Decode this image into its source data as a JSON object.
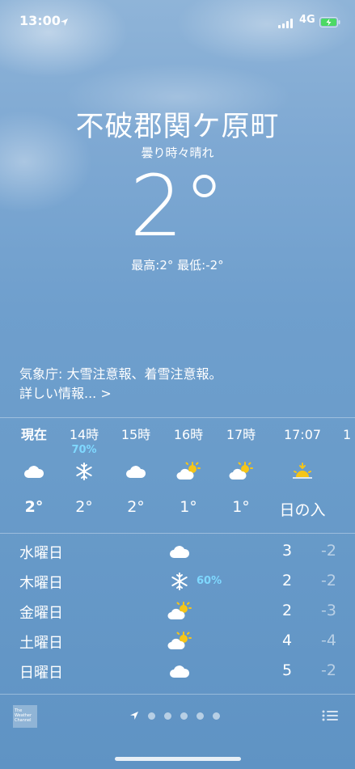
{
  "status_bar": {
    "time": "13:00",
    "network": "4G",
    "battery_charging": true
  },
  "current": {
    "location": "不破郡関ケ原町",
    "condition": "曇り時々晴れ",
    "temperature": "2°",
    "high_low": "最高:2° 最低:-2°"
  },
  "alert": {
    "text": "気象庁: 大雪注意報、着雪注意報。",
    "more_link": "詳しい情報... >"
  },
  "hourly": [
    {
      "label": "現在",
      "precip": "",
      "icon": "cloud-icon",
      "temp": "2°"
    },
    {
      "label": "14時",
      "precip": "70%",
      "icon": "snowflake-icon",
      "temp": "2°"
    },
    {
      "label": "15時",
      "precip": "",
      "icon": "cloud-icon",
      "temp": "2°"
    },
    {
      "label": "16時",
      "precip": "",
      "icon": "partly-sunny-icon",
      "temp": "1°"
    },
    {
      "label": "17時",
      "precip": "",
      "icon": "partly-sunny-icon",
      "temp": "1°"
    },
    {
      "label": "17:07",
      "precip": "",
      "icon": "sunset-icon",
      "temp": "日の入"
    }
  ],
  "daily": [
    {
      "day": "水曜日",
      "icon": "cloud-icon",
      "precip": "",
      "high": "3",
      "low": "-2"
    },
    {
      "day": "木曜日",
      "icon": "snowflake-icon",
      "precip": "60%",
      "high": "2",
      "low": "-2"
    },
    {
      "day": "金曜日",
      "icon": "partly-sunny-icon",
      "precip": "",
      "high": "2",
      "low": "-3"
    },
    {
      "day": "土曜日",
      "icon": "partly-sunny-icon",
      "precip": "",
      "high": "4",
      "low": "-4"
    },
    {
      "day": "日曜日",
      "icon": "cloud-icon",
      "precip": "",
      "high": "5",
      "low": "-2"
    }
  ],
  "footer": {
    "logo_text": "The Weather Channel",
    "page_dots": 5
  },
  "colors": {
    "precip_text": "#7fd8ff",
    "sun": "#f5c518"
  }
}
